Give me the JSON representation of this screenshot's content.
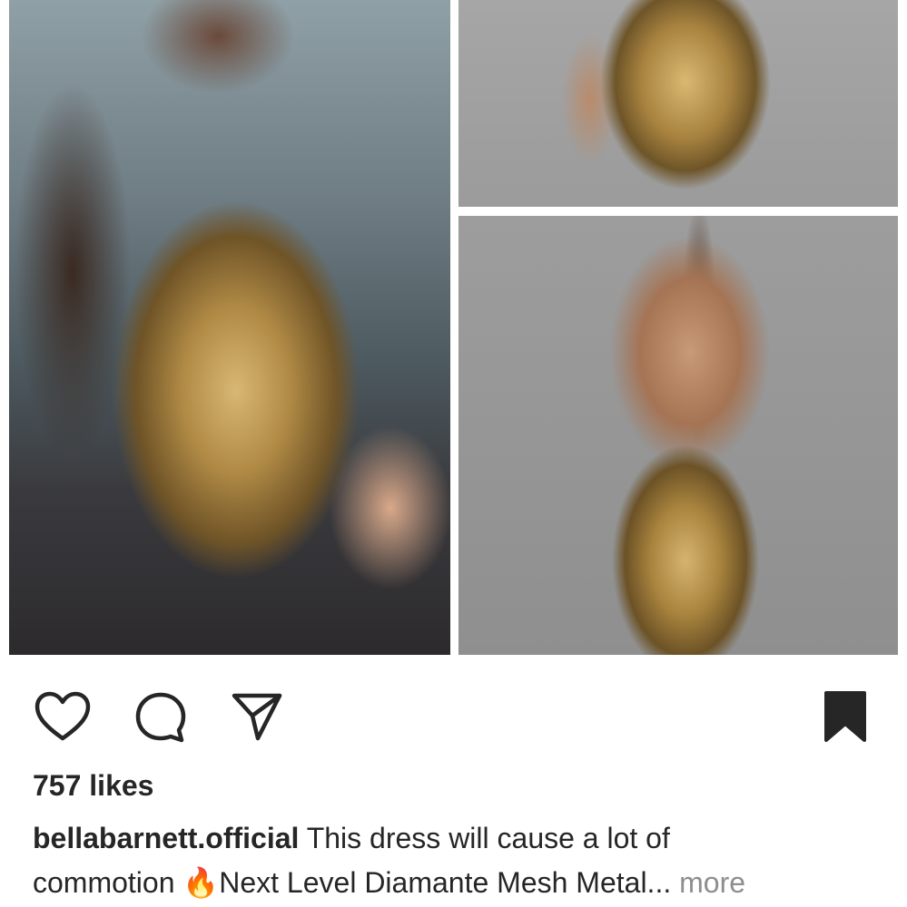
{
  "post": {
    "images": [
      {
        "name": "photo-main",
        "alt": ""
      },
      {
        "name": "photo-top-right",
        "alt": ""
      },
      {
        "name": "photo-bottom-right",
        "alt": ""
      }
    ],
    "actions": {
      "like_icon": "heart-outline-icon",
      "comment_icon": "comment-bubble-icon",
      "share_icon": "paper-plane-icon",
      "save_icon": "bookmark-filled-icon"
    },
    "likes_text": "757 likes",
    "caption": {
      "username": "bellabarnett.official",
      "text_line1": " This dress will cause a lot of",
      "text_line2_start": "commotion ",
      "emoji": "🔥",
      "text_line2_end": "Next Level Diamante Mesh Metal...",
      "more_label": " more"
    }
  }
}
